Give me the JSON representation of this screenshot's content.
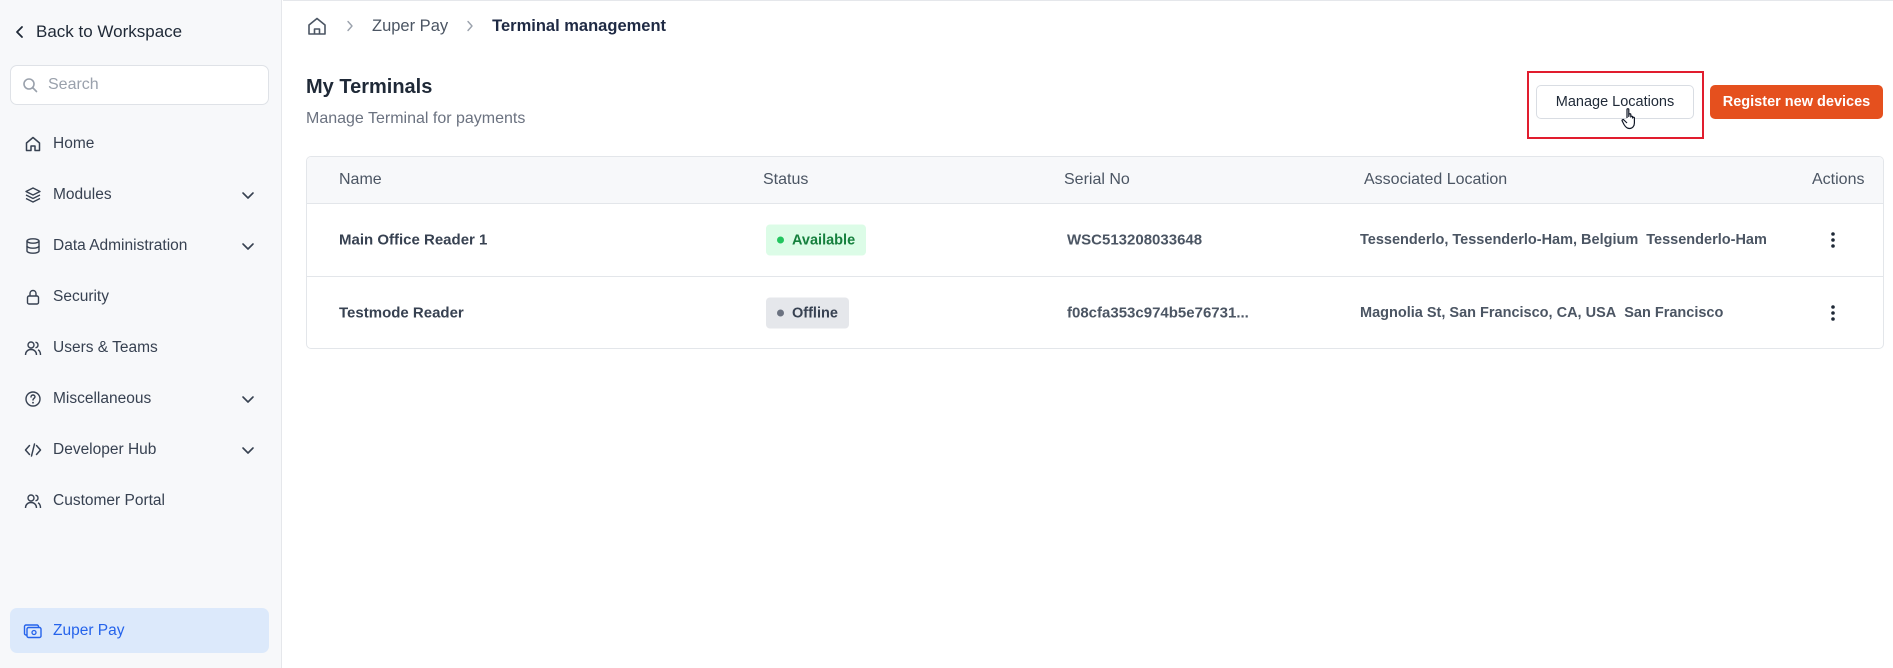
{
  "sidebar": {
    "back_label": "Back to Workspace",
    "search_placeholder": "Search",
    "items": [
      {
        "label": "Home",
        "icon": "home-icon"
      },
      {
        "label": "Modules",
        "icon": "layers-icon",
        "expandable": true
      },
      {
        "label": "Data Administration",
        "icon": "database-icon",
        "expandable": true
      },
      {
        "label": "Security",
        "icon": "lock-icon"
      },
      {
        "label": "Users & Teams",
        "icon": "users-icon"
      },
      {
        "label": "Miscellaneous",
        "icon": "help-circle-icon",
        "expandable": true
      },
      {
        "label": "Developer Hub",
        "icon": "code-icon",
        "expandable": true
      },
      {
        "label": "Customer Portal",
        "icon": "users-icon"
      }
    ],
    "active_item": {
      "label": "Zuper Pay",
      "icon": "payment-icon"
    }
  },
  "breadcrumb": {
    "items": [
      "Zuper Pay",
      "Terminal management"
    ]
  },
  "header": {
    "title": "My Terminals",
    "subtitle": "Manage Terminal for payments",
    "manage_locations_label": "Manage Locations",
    "register_label": "Register new devices"
  },
  "table": {
    "columns": [
      "Name",
      "Status",
      "Serial No",
      "Associated Location",
      "Actions"
    ],
    "rows": [
      {
        "name": "Main Office Reader 1",
        "status": "Available",
        "serial": "WSC513208033648",
        "location": "Tessenderlo, Tessenderlo-Ham, Belgium",
        "city": "Tessenderlo-Ham"
      },
      {
        "name": "Testmode Reader",
        "status": "Offline",
        "serial": "f08cfa353c974b5e76731...",
        "location": "Magnolia St, San Francisco, CA, USA",
        "city": "San Francisco"
      }
    ]
  },
  "colors": {
    "accent": "#e5501e",
    "highlight": "#e11d2e",
    "active_nav_bg": "#dce9fb",
    "active_nav_text": "#2563eb",
    "status_available": "#15803d",
    "status_offline": "#374151"
  }
}
